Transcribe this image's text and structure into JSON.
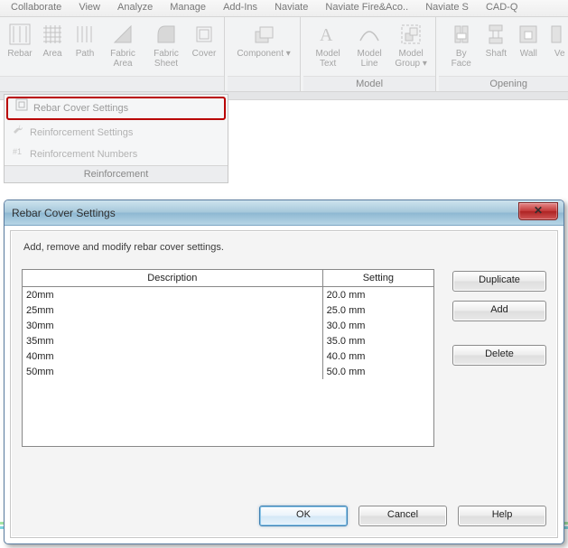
{
  "menu": {
    "items": [
      "Collaborate",
      "View",
      "Analyze",
      "Manage",
      "Add-Ins",
      "Naviate",
      "Naviate Fire&Aco..",
      "Naviate S",
      "CAD-Q"
    ]
  },
  "ribbon": {
    "panels": [
      {
        "title": "",
        "buttons": [
          {
            "label": "Rebar"
          },
          {
            "label": "Area"
          },
          {
            "label": "Path"
          },
          {
            "label": "Fabric Area"
          },
          {
            "label": "Fabric Sheet"
          },
          {
            "label": "Cover"
          }
        ]
      },
      {
        "title": "",
        "buttons": [
          {
            "label": "Component ▾"
          }
        ]
      },
      {
        "title": "Model",
        "buttons": [
          {
            "label": "Model Text"
          },
          {
            "label": "Model Line"
          },
          {
            "label": "Model Group ▾"
          }
        ]
      },
      {
        "title": "Opening",
        "buttons": [
          {
            "label": "By Face"
          },
          {
            "label": "Shaft"
          },
          {
            "label": "Wall"
          },
          {
            "label": "Ve"
          }
        ]
      }
    ]
  },
  "reinforcement": {
    "items": [
      {
        "label": "Rebar Cover Settings",
        "highlight": true
      },
      {
        "label": "Reinforcement Settings",
        "highlight": false
      },
      {
        "label": "Reinforcement Numbers",
        "highlight": false
      }
    ],
    "title": "Reinforcement"
  },
  "dialog": {
    "title": "Rebar Cover Settings",
    "instruction": "Add, remove and modify rebar cover settings.",
    "columns": {
      "description": "Description",
      "setting": "Setting"
    },
    "rows": [
      {
        "description": "20mm",
        "setting": "20.0 mm"
      },
      {
        "description": "25mm",
        "setting": "25.0 mm"
      },
      {
        "description": "30mm",
        "setting": "30.0 mm"
      },
      {
        "description": "35mm",
        "setting": "35.0 mm"
      },
      {
        "description": "40mm",
        "setting": "40.0 mm"
      },
      {
        "description": "50mm",
        "setting": "50.0 mm"
      }
    ],
    "buttons": {
      "duplicate": "Duplicate",
      "add": "Add",
      "delete": "Delete",
      "ok": "OK",
      "cancel": "Cancel",
      "help": "Help"
    }
  }
}
